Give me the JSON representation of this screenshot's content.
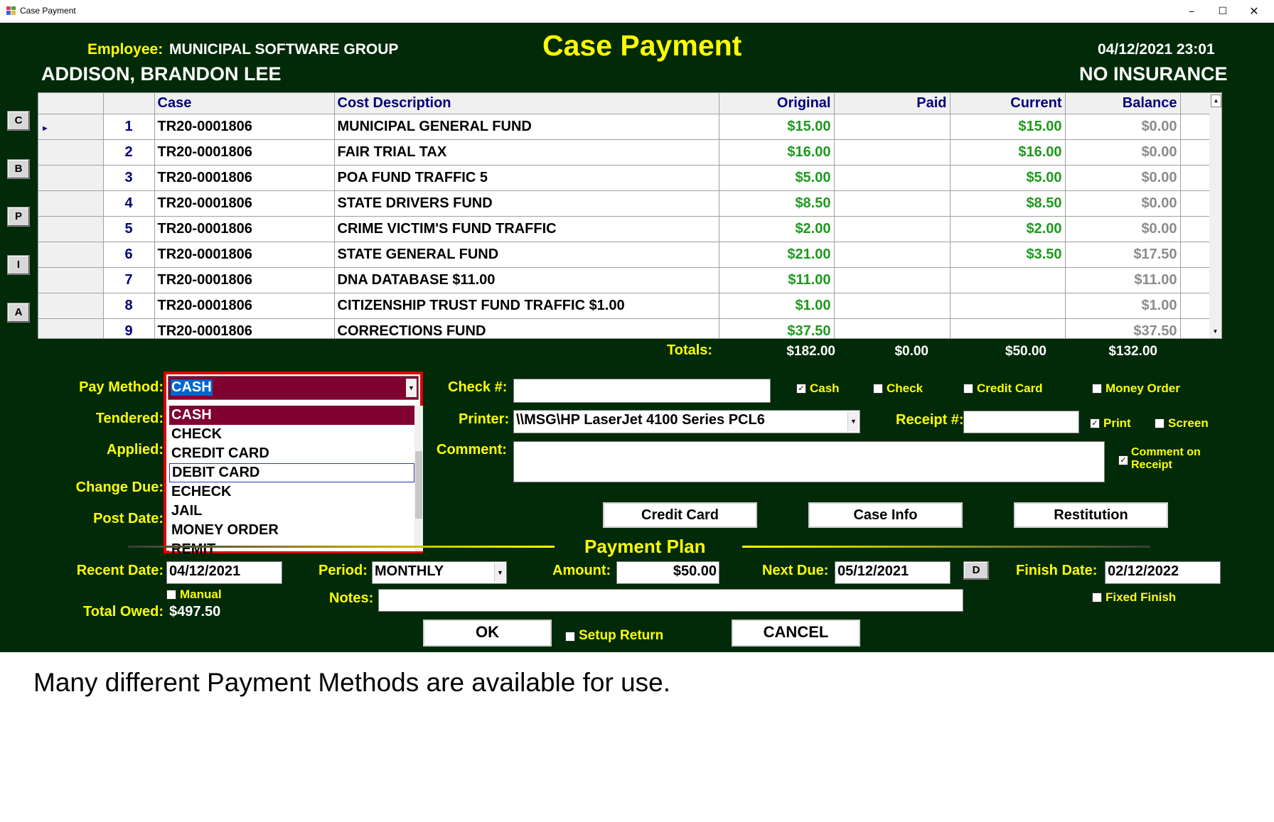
{
  "window": {
    "title": "Case Payment",
    "controls": [
      "–",
      "☐",
      "✕"
    ]
  },
  "header": {
    "employee_label": "Employee:",
    "employee_name": "MUNICIPAL SOFTWARE GROUP",
    "form_title": "Case Payment",
    "datetime": "04/12/2021 23:01",
    "person_name": "ADDISON, BRANDON LEE",
    "insurance": "NO INSURANCE"
  },
  "side_buttons": [
    "C",
    "B",
    "P",
    "I",
    "A"
  ],
  "grid": {
    "columns": [
      "Case",
      "Cost Description",
      "Original",
      "Paid",
      "Current",
      "Balance"
    ],
    "rows": [
      {
        "n": "1",
        "case": "TR20-0001806",
        "desc": "MUNICIPAL GENERAL FUND",
        "original": "$15.00",
        "paid": "",
        "current": "$15.00",
        "balance": "$0.00"
      },
      {
        "n": "2",
        "case": "TR20-0001806",
        "desc": "FAIR TRIAL TAX",
        "original": "$16.00",
        "paid": "",
        "current": "$16.00",
        "balance": "$0.00"
      },
      {
        "n": "3",
        "case": "TR20-0001806",
        "desc": "POA FUND TRAFFIC 5",
        "original": "$5.00",
        "paid": "",
        "current": "$5.00",
        "balance": "$0.00"
      },
      {
        "n": "4",
        "case": "TR20-0001806",
        "desc": "STATE DRIVERS FUND",
        "original": "$8.50",
        "paid": "",
        "current": "$8.50",
        "balance": "$0.00"
      },
      {
        "n": "5",
        "case": "TR20-0001806",
        "desc": "CRIME VICTIM'S FUND TRAFFIC",
        "original": "$2.00",
        "paid": "",
        "current": "$2.00",
        "balance": "$0.00"
      },
      {
        "n": "6",
        "case": "TR20-0001806",
        "desc": "STATE GENERAL FUND",
        "original": "$21.00",
        "paid": "",
        "current": "$3.50",
        "balance": "$17.50"
      },
      {
        "n": "7",
        "case": "TR20-0001806",
        "desc": "DNA DATABASE $11.00",
        "original": "$11.00",
        "paid": "",
        "current": "",
        "balance": "$11.00"
      },
      {
        "n": "8",
        "case": "TR20-0001806",
        "desc": "CITIZENSHIP TRUST FUND TRAFFIC $1.00",
        "original": "$1.00",
        "paid": "",
        "current": "",
        "balance": "$1.00"
      },
      {
        "n": "9",
        "case": "TR20-0001806",
        "desc": "CORRECTIONS FUND",
        "original": "$37.50",
        "paid": "",
        "current": "",
        "balance": "$37.50"
      }
    ]
  },
  "totals": {
    "label": "Totals:",
    "original": "$182.00",
    "paid": "$0.00",
    "current": "$50.00",
    "balance": "$132.00"
  },
  "payment": {
    "pay_method_label": "Pay Method:",
    "pay_method_value": "CASH",
    "pay_method_options": [
      "CASH",
      "CHECK",
      "CREDIT CARD",
      "DEBIT CARD",
      "ECHECK",
      "JAIL",
      "MONEY ORDER",
      "REMIT"
    ],
    "tendered_label": "Tendered:",
    "applied_label": "Applied:",
    "change_due_label": "Change Due:",
    "post_date_label": "Post Date:",
    "check_label": "Check #:",
    "check_value": "",
    "printer_label": "Printer:",
    "printer_value": "\\\\MSG\\HP LaserJet 4100 Series PCL6",
    "receipt_label": "Receipt #:",
    "receipt_value": "",
    "comment_label": "Comment:",
    "comment_value": ""
  },
  "checkboxes": {
    "cash": {
      "label": "Cash",
      "checked": true
    },
    "check": {
      "label": "Check",
      "checked": false
    },
    "credit_card": {
      "label": "Credit Card",
      "checked": false
    },
    "money_order": {
      "label": "Money Order",
      "checked": false
    },
    "print": {
      "label": "Print",
      "checked": true
    },
    "screen": {
      "label": "Screen",
      "checked": false
    },
    "comment_on_receipt_1": "Comment on",
    "comment_on_receipt_2": "Receipt",
    "manual": {
      "label": "Manual",
      "checked": false
    },
    "fixed_finish": {
      "label": "Fixed Finish",
      "checked": false
    },
    "setup_return": {
      "label": "Setup Return",
      "checked": false
    }
  },
  "buttons": {
    "credit_card": "Credit Card",
    "case_info": "Case Info",
    "restitution": "Restitution",
    "ok": "OK",
    "cancel": "CANCEL",
    "d": "D"
  },
  "plan": {
    "title": "Payment Plan",
    "recent_date_label": "Recent Date:",
    "recent_date": "04/12/2021",
    "period_label": "Period:",
    "period": "MONTHLY",
    "amount_label": "Amount:",
    "amount": "$50.00",
    "next_due_label": "Next Due:",
    "next_due": "05/12/2021",
    "finish_date_label": "Finish Date:",
    "finish_date": "02/12/2022",
    "notes_label": "Notes:",
    "notes": "",
    "total_owed_label": "Total Owed:",
    "total_owed": "$497.50"
  },
  "caption": "Many different Payment Methods are available for use.",
  "colors": {
    "background": "#002a08",
    "label": "#ffff00",
    "amount_green": "#1d9a1d",
    "balance_gray": "#8c8c8c",
    "highlight": "#800030",
    "dropdown_outline": "#e00000"
  }
}
